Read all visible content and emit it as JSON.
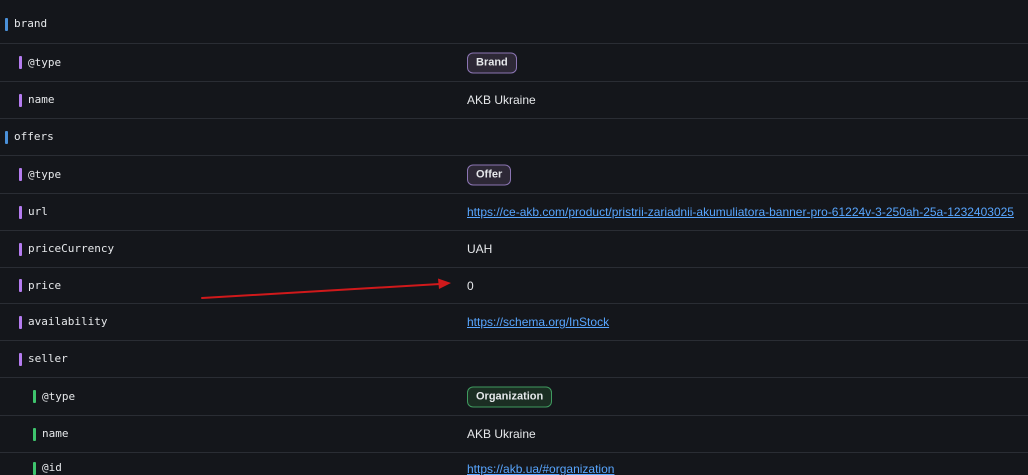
{
  "rows": [
    {
      "key": "brand",
      "value": "",
      "kind": "none"
    },
    {
      "key": "@type",
      "value": "Brand",
      "kind": "badge"
    },
    {
      "key": "name",
      "value": "AKB Ukraine",
      "kind": "text"
    },
    {
      "key": "offers",
      "value": "",
      "kind": "none"
    },
    {
      "key": "@type",
      "value": "Offer",
      "kind": "badge"
    },
    {
      "key": "url",
      "value": "https://ce-akb.com/product/pristrii-zariadnii-akumuliatora-banner-pro-61224v-3-250ah-25a-1232403025",
      "kind": "link"
    },
    {
      "key": "priceCurrency",
      "value": "UAH",
      "kind": "text"
    },
    {
      "key": "price",
      "value": "0",
      "kind": "text"
    },
    {
      "key": "availability",
      "value": "https://schema.org/InStock",
      "kind": "link"
    },
    {
      "key": "seller",
      "value": "",
      "kind": "none"
    },
    {
      "key": "@type",
      "value": "Organization",
      "kind": "badge"
    },
    {
      "key": "name",
      "value": "AKB Ukraine",
      "kind": "text"
    },
    {
      "key": "@id",
      "value": "https://akb.ua/#organization",
      "kind": "link"
    }
  ],
  "colors": {
    "background": "#14161b",
    "divider": "#2a2d34",
    "level0_bar": "#4a90d9",
    "level1_bar": "#b57cf0",
    "level2_bar": "#3ec46d",
    "link": "#58a6ff",
    "annotation_arrow": "#d0191b"
  },
  "annotation": {
    "icon": "red-arrow-icon",
    "points_to": "price"
  }
}
